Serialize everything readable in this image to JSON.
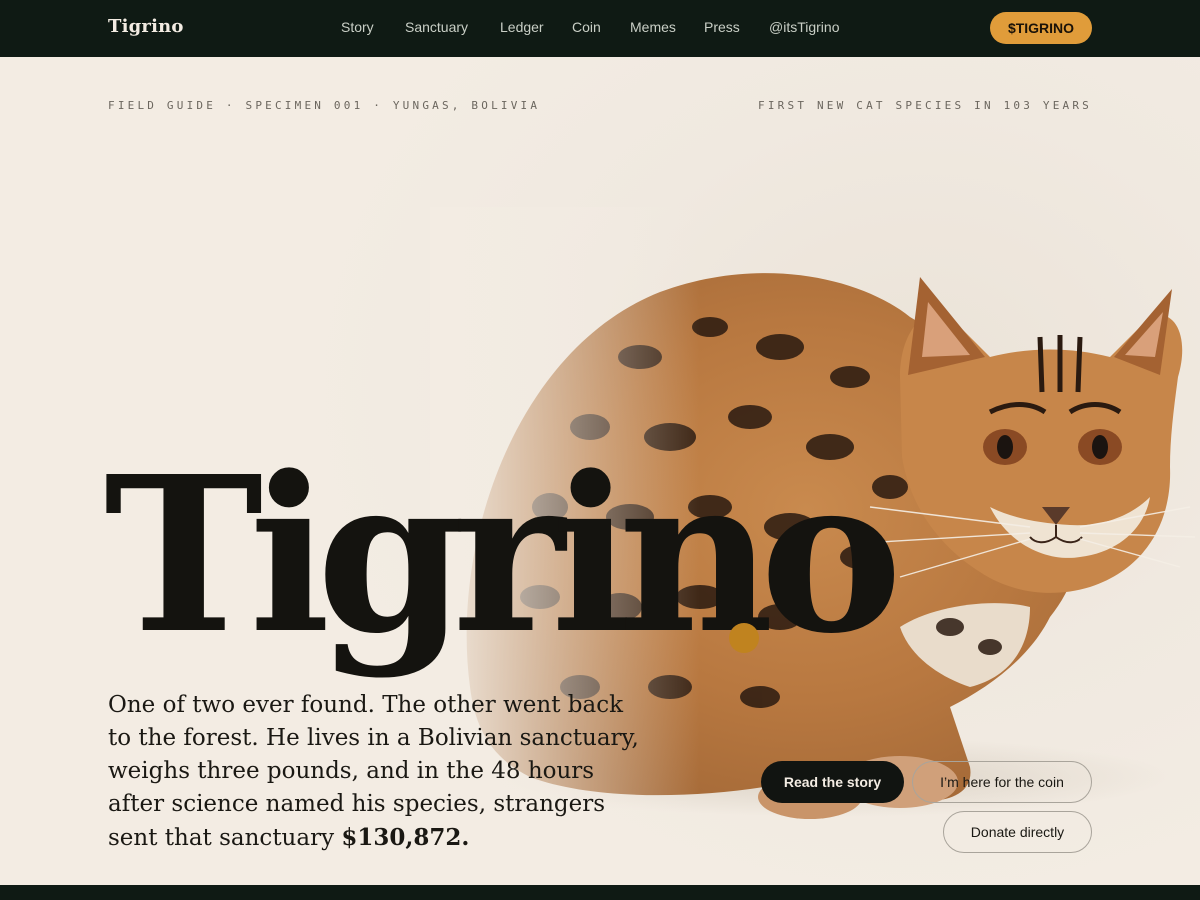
{
  "header": {
    "brand": "Tigrino",
    "nav": [
      "Story",
      "Sanctuary",
      "Ledger",
      "Coin",
      "Memes",
      "Press",
      "@itsTigrino"
    ],
    "ticker_button": "$TIGRINO"
  },
  "hero": {
    "meta_left": "FIELD GUIDE · SPECIMEN 001 · YUNGAS, BOLIVIA",
    "meta_right": "FIRST NEW CAT SPECIES IN 103 YEARS",
    "title": "Tigrino",
    "lede_text": "One of two ever found. The other went back to the forest. He lives in a Bolivian sanctuary, weighs three pounds, and in the 48 hours after science named his species, strangers sent that sanctuary",
    "lede_amount": "$130,872.",
    "buttons": {
      "read_story": "Read the story",
      "coin": "I’m here for the coin",
      "donate": "Donate directly"
    }
  },
  "colors": {
    "nav_bg": "#0f1a14",
    "page_bg": "#f3ece3",
    "accent": "#e09c3a",
    "dot": "#c0831f",
    "ink": "#14130f"
  }
}
